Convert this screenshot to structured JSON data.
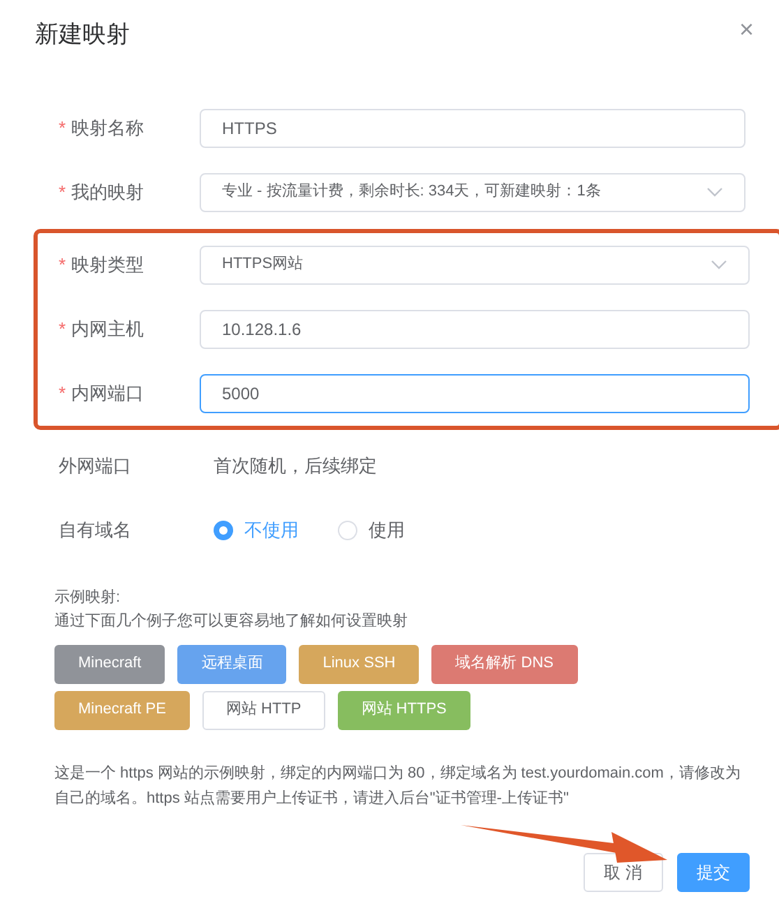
{
  "dialog": {
    "title": "新建映射",
    "close": "×"
  },
  "sections": [
    {
      "highlighted": false,
      "fields": [
        {
          "kind": "input",
          "required_mark": "*",
          "label": "映射名称",
          "value": "HTTPS",
          "focused": false
        },
        {
          "kind": "select",
          "required_mark": "*",
          "label": "我的映射",
          "value": "专业 - 按流量计费，剩余时长: 334天，可新建映射：1条",
          "focused": false
        }
      ]
    },
    {
      "highlighted": true,
      "fields": [
        {
          "kind": "select",
          "required_mark": "*",
          "label": "映射类型",
          "value": "HTTPS网站",
          "focused": false
        },
        {
          "kind": "input",
          "required_mark": "*",
          "label": "内网主机",
          "value": "10.128.1.6",
          "focused": false
        },
        {
          "kind": "input",
          "required_mark": "*",
          "label": "内网端口",
          "value": "5000",
          "focused": true
        }
      ]
    },
    {
      "highlighted": false,
      "fields": [
        {
          "kind": "static",
          "label": "外网端口",
          "value": "首次随机，后续绑定"
        },
        {
          "kind": "radio",
          "label": "自有域名",
          "options": [
            {
              "label": "不使用",
              "selected": true
            },
            {
              "label": "使用",
              "selected": false
            }
          ]
        }
      ]
    }
  ],
  "examples": {
    "title": "示例映射:",
    "subtitle": "通过下面几个例子您可以更容易地了解如何设置映射",
    "buttons": [
      {
        "label": "Minecraft",
        "color": "#909399"
      },
      {
        "label": "远程桌面",
        "color": "#66a3ee"
      },
      {
        "label": "Linux SSH",
        "color": "#d6a75c"
      },
      {
        "label": "域名解析 DNS",
        "color": "#dc7a72"
      },
      {
        "label": "Minecraft PE",
        "color": "#d6a75c"
      },
      {
        "label": "网站 HTTP",
        "color": "#ffffff"
      },
      {
        "label": "网站 HTTPS",
        "color": "#87bd5f"
      }
    ]
  },
  "description": "这是一个 https 网站的示例映射，绑定的内网端口为 80，绑定域名为 test.yourdomain.com，请修改为自己的域名。https 站点需要用户上传证书，请进入后台\"证书管理-上传证书\"",
  "footer": {
    "cancel": "取 消",
    "submit": "提交"
  }
}
